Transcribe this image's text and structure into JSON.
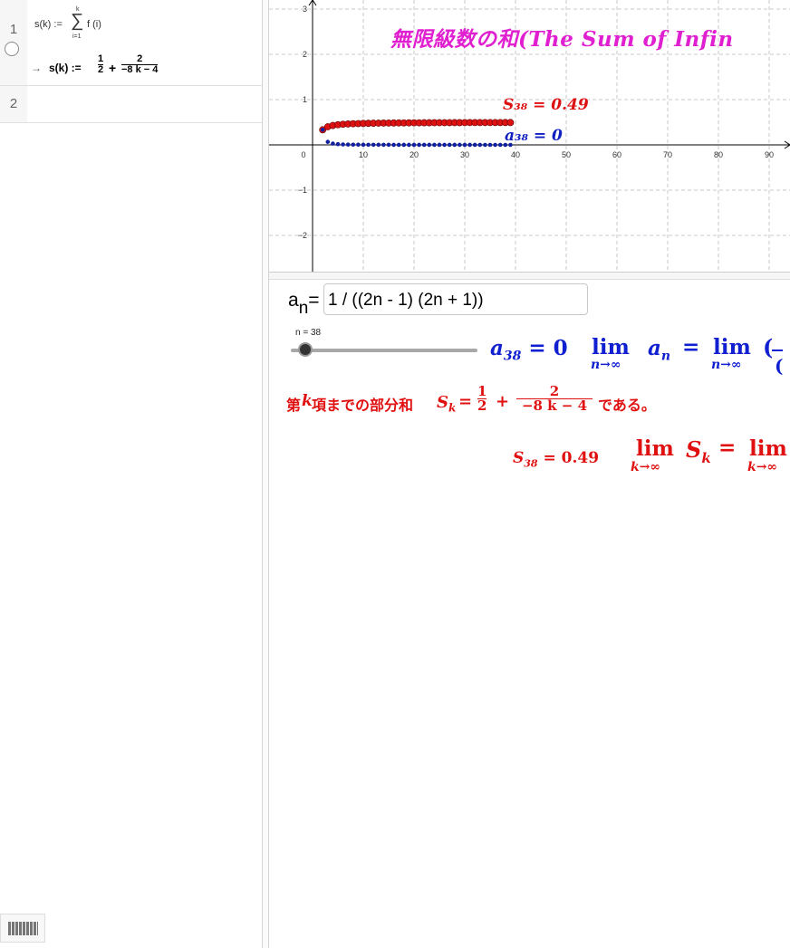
{
  "algebra": {
    "row1": {
      "number": "1",
      "definition": {
        "lhs": "s(k) :=",
        "sum_top": "k",
        "sum_bottom": "i=1",
        "body": "f (i)"
      },
      "output": {
        "arrow": "→",
        "lhs": "s(k) :=",
        "frac1_num": "1",
        "frac1_den": "2",
        "plus": "+",
        "frac2_num": "2",
        "frac2_den": "−8 k − 4"
      }
    },
    "row2": {
      "number": "2"
    }
  },
  "graph": {
    "x_ticks": [
      "0",
      "10",
      "20",
      "30",
      "40",
      "50",
      "60",
      "70",
      "80",
      "90"
    ],
    "y_ticks": [
      "3",
      "2",
      "1",
      "−1",
      "−2"
    ],
    "title": "無限級数の和(The Sum of Infin",
    "label_S": "S₃₈ = 0.49",
    "label_a": "a₃₈ = 0",
    "series_colors": {
      "partial_sums": "#dd1111",
      "terms": "#1020a0"
    },
    "chart_data": {
      "type": "scatter",
      "x_range": [
        2,
        38
      ],
      "series": [
        {
          "name": "S_k",
          "formula": "1/2 + 2/(-8k - 4)",
          "n_from": 1,
          "n_to": 38
        },
        {
          "name": "a_n",
          "formula": "1/((2n-1)(2n+1))",
          "n_from": 1,
          "n_to": 38
        }
      ]
    }
  },
  "input": {
    "label_main": "a",
    "label_sub": "n",
    "equals": "=",
    "value": "1 / ((2n - 1) (2n + 1))"
  },
  "slider": {
    "label": "n = 38",
    "value_fraction": 0.05
  },
  "text": {
    "a_value_lhs": "a",
    "a_value_sub": "38",
    "a_value_rhs": "= 0",
    "lim_word": "lim",
    "lim_sub_n": "n→∞",
    "a_n": "a",
    "a_n_sub": "n",
    "equals": "=",
    "lim2_sub": "n→∞",
    "paren_start": "(",
    "jp_prefix": "第",
    "jp_k": "k",
    "jp_middle": "項までの部分和",
    "S_k": "S",
    "S_k_sub": "k",
    "S_frac1_num": "1",
    "S_frac1_den": "2",
    "S_frac2_num": "2",
    "S_frac2_den": "−8 k − 4",
    "jp_suffix": "である。",
    "S38": "S",
    "S38_sub": "38",
    "S38_rhs": "= 0.49",
    "lim_sub_k": "k→∞",
    "lim_S": "S",
    "lim_S_sub": "k",
    "lim_cut": "lim",
    "lim_cut_sub": "k→∞"
  }
}
